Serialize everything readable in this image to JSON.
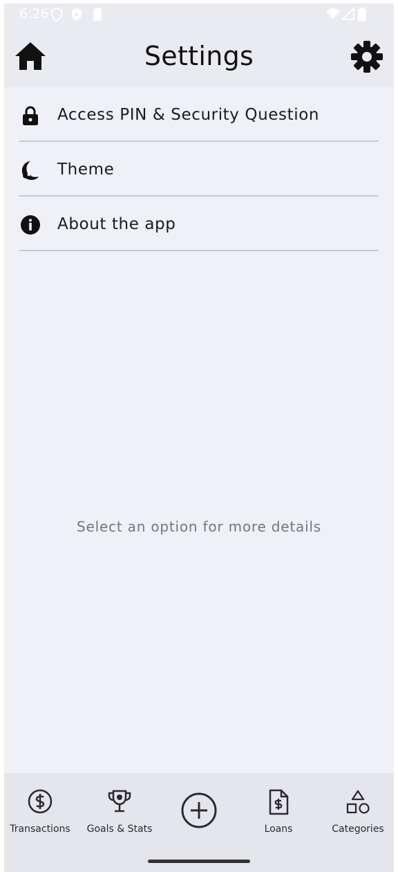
{
  "status_bar": {
    "time": "6:26",
    "left_icons": [
      "shield-icon",
      "play-protect-icon",
      "sd-card-icon"
    ],
    "right_icons": [
      "wifi-icon",
      "cell-signal-icon",
      "battery-icon"
    ]
  },
  "app_bar": {
    "title": "Settings",
    "left_icon": "home-icon",
    "right_icon": "gear-icon"
  },
  "menu": {
    "items": [
      {
        "label": "Access PIN & Security Question",
        "icon": "lock-icon"
      },
      {
        "label": "Theme",
        "icon": "theme-moon-icon"
      },
      {
        "label": "About the app",
        "icon": "info-icon"
      }
    ]
  },
  "main": {
    "placeholder": "Select an option for more details"
  },
  "bottom_nav": {
    "items": [
      {
        "label": "Transactions",
        "icon": "dollar-circle-icon"
      },
      {
        "label": "Goals & Stats",
        "icon": "trophy-icon"
      },
      {
        "label": "",
        "icon": "add-circle-icon"
      },
      {
        "label": "Loans",
        "icon": "dollar-document-icon"
      },
      {
        "label": "Categories",
        "icon": "shapes-icon"
      }
    ]
  },
  "colors": {
    "background": "#eff1f6",
    "bar": "#e9ebf0",
    "nav": "#e4e6eb",
    "text": "#1b1b1f",
    "secondary_text": "#74767c"
  }
}
